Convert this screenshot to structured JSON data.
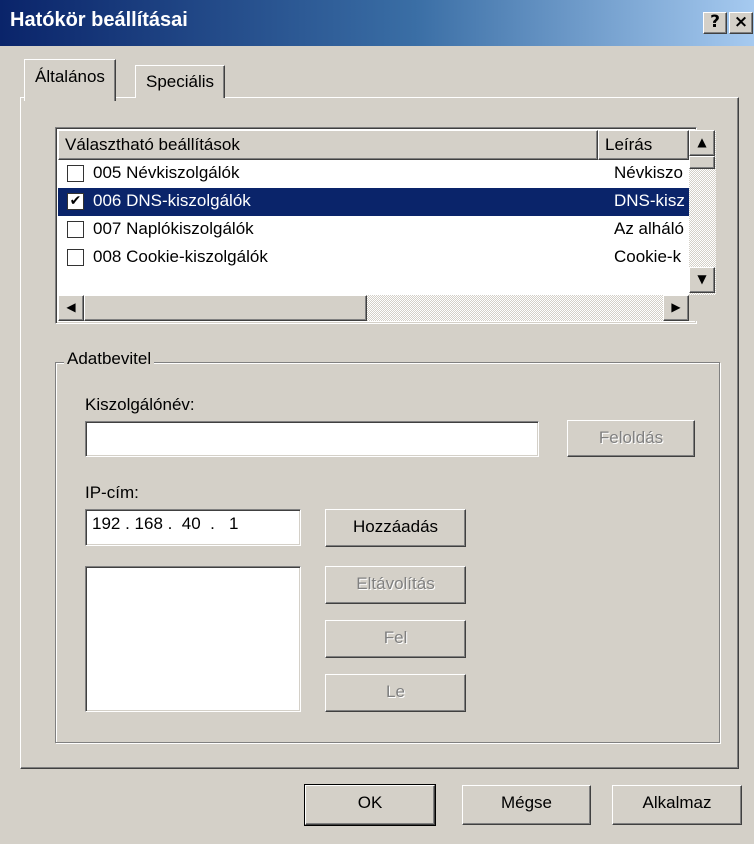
{
  "window": {
    "title": "Hatókör beállításai",
    "help_label": "?",
    "close_label": "×"
  },
  "tabs": [
    {
      "label": "Általános",
      "active": true
    },
    {
      "label": "Speciális",
      "active": false
    }
  ],
  "options_list": {
    "columns": [
      "Választható beállítások",
      "Leírás"
    ],
    "rows": [
      {
        "name": "005 Névkiszolgálók",
        "description": "Névkiszo",
        "checked": false,
        "selected": false
      },
      {
        "name": "006 DNS-kiszolgálók",
        "description": "DNS-kisz",
        "checked": true,
        "selected": true
      },
      {
        "name": "007 Naplókiszolgálók",
        "description": "Az alháló",
        "checked": false,
        "selected": false
      },
      {
        "name": "008 Cookie-kiszolgálók",
        "description": "Cookie-k",
        "checked": false,
        "selected": false
      }
    ]
  },
  "data_entry": {
    "legend": "Adatbevitel",
    "server_name_label": "Kiszolgálónév:",
    "server_name_value": "",
    "resolve_button": "Feloldás",
    "ip_label": "IP-cím:",
    "ip_value": "192 . 168 .  40  .   1",
    "add_button": "Hozzáadás",
    "remove_button": "Eltávolítás",
    "up_button": "Fel",
    "down_button": "Le"
  },
  "footer": {
    "ok": "OK",
    "cancel": "Mégse",
    "apply": "Alkalmaz"
  }
}
